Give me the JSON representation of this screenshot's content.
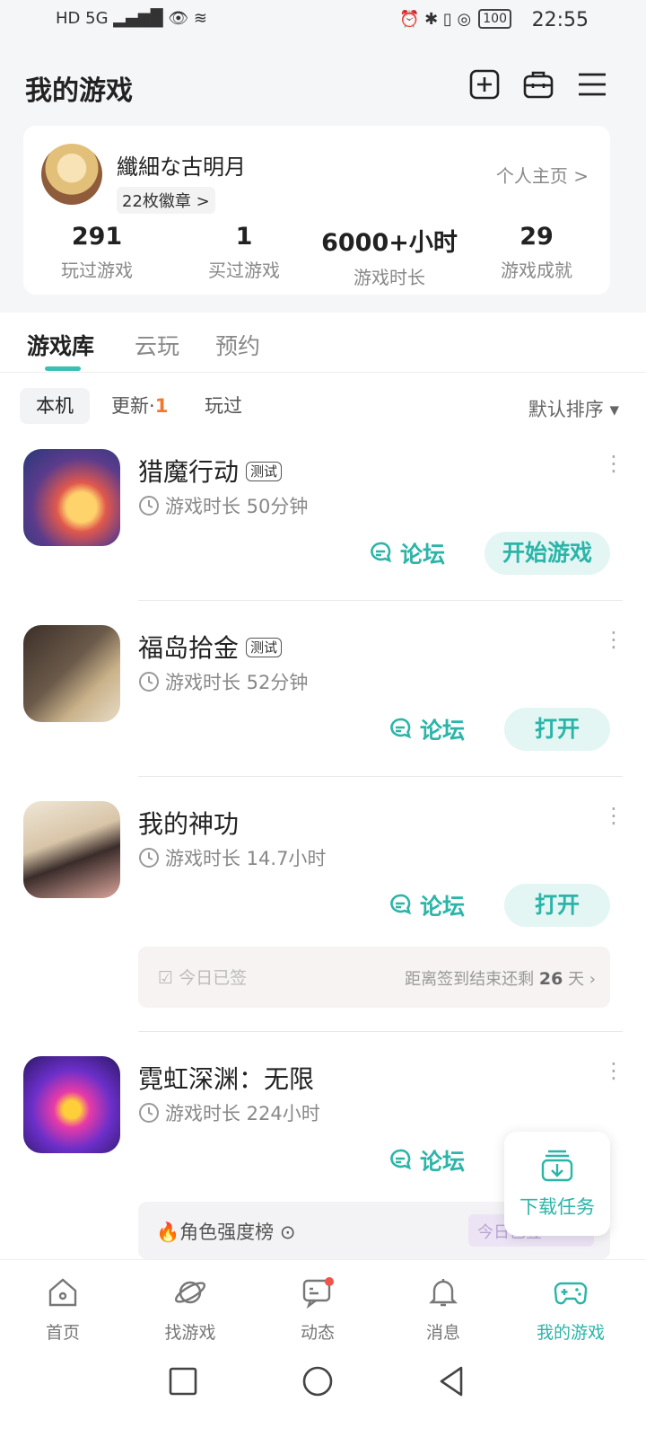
{
  "status_bar": {
    "left_icons": "HD 5G ▂▄▆█ 👁 ≋",
    "right_icons": "⏰ ✱ ▯ ◎",
    "battery": "100",
    "time": "22:55"
  },
  "header": {
    "title": "我的游戏",
    "icons": [
      "add-icon",
      "toolbox-icon",
      "menu-icon"
    ]
  },
  "profile": {
    "username": "纖細な古明月",
    "badges": "22枚徽章 >",
    "profile_link": "个人主页 >",
    "stats": [
      {
        "value": "291",
        "label": "玩过游戏"
      },
      {
        "value": "1",
        "label": "买过游戏"
      },
      {
        "value": "6000+小时",
        "label": "游戏时长"
      },
      {
        "value": "29",
        "label": "游戏成就"
      }
    ]
  },
  "tabs": [
    {
      "label": "游戏库",
      "active": true
    },
    {
      "label": "云玩",
      "active": false
    },
    {
      "label": "预约",
      "active": false
    }
  ],
  "filters": {
    "local": "本机",
    "update": "更新·",
    "update_count": "1",
    "played": "玩过",
    "sort": "默认排序 ▾"
  },
  "games": [
    {
      "name": "猎魔行动",
      "tag": "测试",
      "playtime": "游戏时长 50分钟",
      "forum": "论坛",
      "action": "开始游戏"
    },
    {
      "name": "福岛拾金",
      "tag": "测试",
      "playtime": "游戏时长 52分钟",
      "forum": "论坛",
      "action": "打开"
    },
    {
      "name": "我的神功",
      "tag": "",
      "playtime": "游戏时长 14.7小时",
      "forum": "论坛",
      "action": "打开",
      "checkin": {
        "status": "今日已签",
        "remaining_prefix": "距离签到结束还剩",
        "days": "26",
        "suffix": "天 ›"
      }
    },
    {
      "name": "霓虹深渊：无限",
      "tag": "",
      "playtime": "游戏时长 224小时",
      "forum": "论坛",
      "action": ""
    }
  ],
  "rank_card": {
    "label": "🔥角色强度榜 ⊙",
    "signed": "今日已签"
  },
  "download_task": {
    "label": "下载任务"
  },
  "bottom_nav": [
    {
      "label": "首页",
      "icon": "home-icon"
    },
    {
      "label": "找游戏",
      "icon": "planet-icon"
    },
    {
      "label": "动态",
      "icon": "chat-icon"
    },
    {
      "label": "消息",
      "icon": "bell-icon"
    },
    {
      "label": "我的游戏",
      "icon": "gamepad-icon",
      "active": true
    }
  ],
  "colors": {
    "accent": "#2bb5a8",
    "accent_bg": "#e3f6f4",
    "update_count": "#f0792f"
  }
}
